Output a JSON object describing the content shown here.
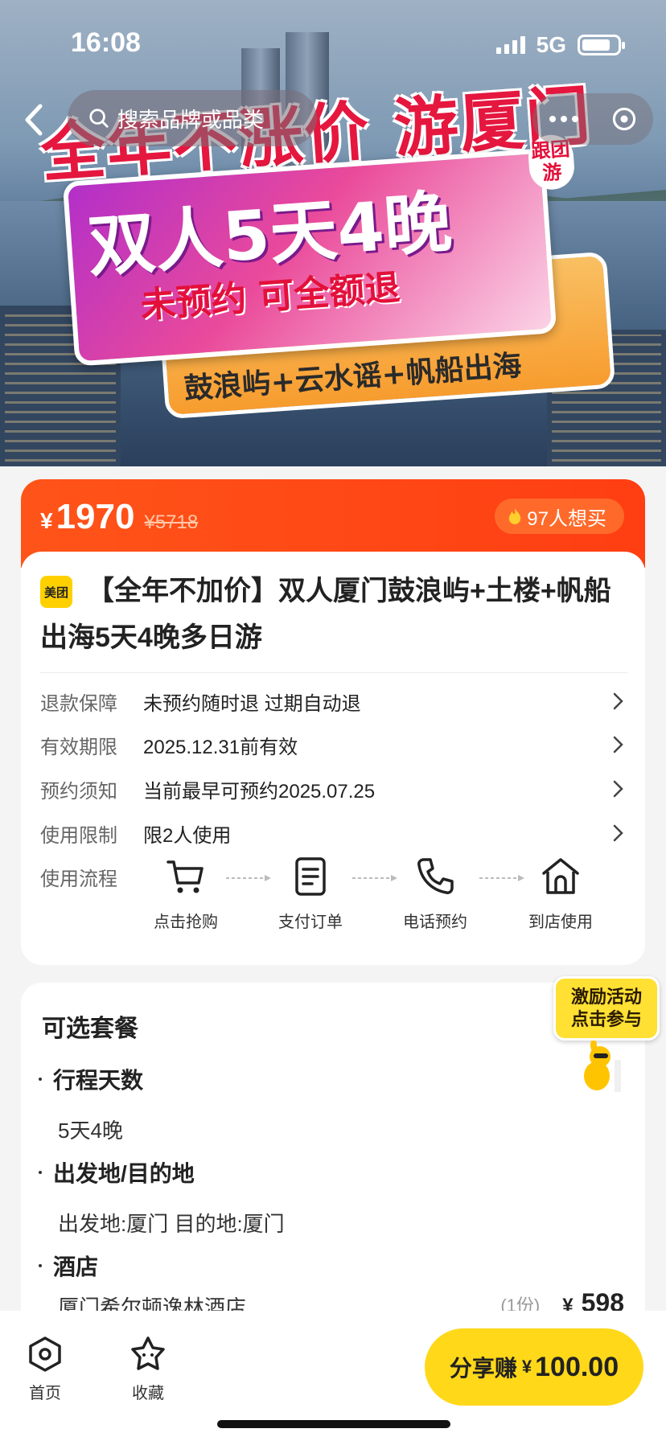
{
  "status": {
    "time": "16:08",
    "network": "5G"
  },
  "search": {
    "placeholder": "搜索品牌或品类"
  },
  "banner": {
    "headline": "全年不涨价 游厦门",
    "main": "双人5天4晚",
    "tag": "跟团游",
    "sub": "未预约 可全额退",
    "route": "鼓浪屿+云水谣+帆船出海"
  },
  "price": {
    "currency": "¥",
    "current": "1970",
    "original": "¥5718",
    "want": "97人想买"
  },
  "product": {
    "brand": "美团",
    "title": "【全年不加价】双人厦门鼓浪屿+土楼+帆船出海5天4晚多日游"
  },
  "info": [
    {
      "key": "退款保障",
      "value": "未预约随时退 过期自动退"
    },
    {
      "key": "有效期限",
      "value": "2025.12.31前有效"
    },
    {
      "key": "预约须知",
      "value": "当前最早可预约2025.07.25"
    },
    {
      "key": "使用限制",
      "value": "限2人使用"
    }
  ],
  "flow": {
    "label": "使用流程",
    "steps": [
      "点击抢购",
      "支付订单",
      "电话预约",
      "到店使用"
    ]
  },
  "options": {
    "title": "可选套餐",
    "sections": [
      {
        "heading": "行程天数",
        "value": "5天4晚"
      },
      {
        "heading": "出发地/目的地",
        "value": "出发地:厦门 目的地:厦门"
      },
      {
        "heading": "酒店",
        "value": "厦门希尔顿逸林酒店"
      }
    ],
    "hotel_count": "(1份)",
    "hotel_currency": "¥",
    "hotel_price": "598"
  },
  "promo": {
    "line1": "激励活动",
    "line2": "点击参与"
  },
  "bottom": {
    "home": "首页",
    "favorite": "收藏",
    "share_label": "分享赚",
    "share_currency": "¥",
    "share_amount": "100.00"
  },
  "colors": {
    "accent": "#ff4a14",
    "share": "#ffd81a",
    "brand": "#ffd000"
  }
}
